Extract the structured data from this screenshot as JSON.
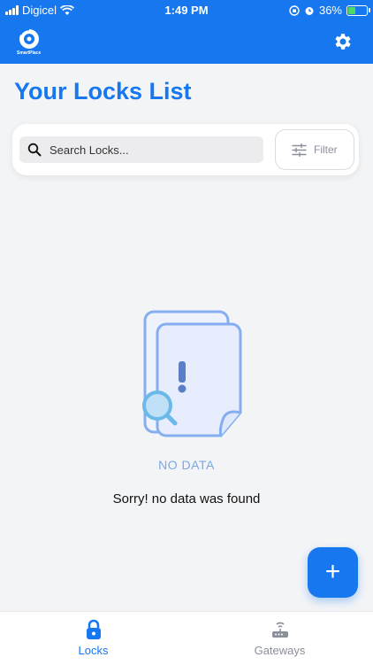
{
  "status_bar": {
    "carrier": "Digicel",
    "time": "1:49 PM",
    "battery_percent": "36%"
  },
  "app": {
    "brand": "SmartPlace",
    "primary_color": "#1677ee"
  },
  "page": {
    "title": "Your Locks List"
  },
  "search": {
    "placeholder": "Search Locks...",
    "value": "",
    "filter_label": "Filter"
  },
  "empty_state": {
    "label": "NO DATA",
    "message": "Sorry! no data was found"
  },
  "fab": {
    "label": "+"
  },
  "bottom_nav": {
    "items": [
      {
        "label": "Locks",
        "icon": "lock-icon",
        "active": true
      },
      {
        "label": "Gateways",
        "icon": "router-icon",
        "active": false
      }
    ]
  }
}
